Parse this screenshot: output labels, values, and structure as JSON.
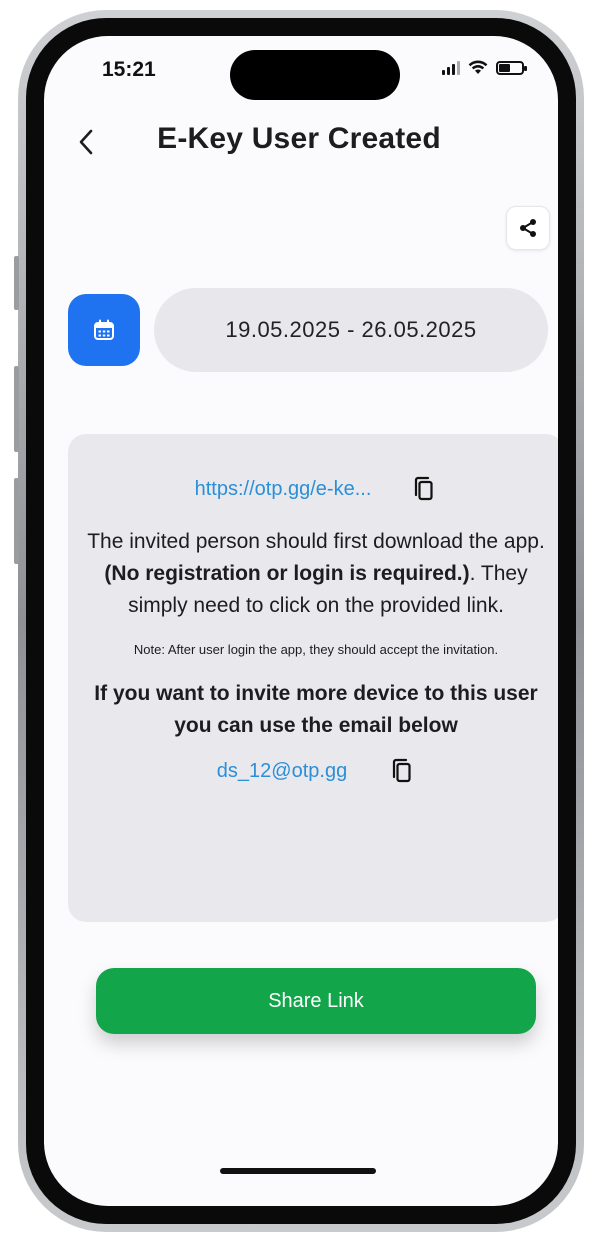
{
  "status_bar": {
    "time": "15:21"
  },
  "header": {
    "title": "E-Key User Created",
    "back_icon": "chevron-left-icon"
  },
  "toolbar": {
    "share_icon": "share-icon"
  },
  "date_range": {
    "icon": "calendar-icon",
    "value": "19.05.2025 - 26.05.2025"
  },
  "info_card": {
    "link": "https://otp.gg/e-ke...",
    "instructions_part1": "The invited person should first download the app. ",
    "instructions_bold": "(No registration or login is required.)",
    "instructions_part2": ". They simply need to click on the provided link.",
    "note": "Note: After user login the app, they should accept the invitation.",
    "invite_heading": "If you want to invite more device to this user you can use the email below",
    "email": "ds_12@otp.gg"
  },
  "actions": {
    "share_link_label": "Share Link"
  },
  "colors": {
    "accent_blue": "#1f73f0",
    "link_blue": "#2b8fd8",
    "primary_green": "#13a54a",
    "card_bg": "#e9e9ed",
    "pill_bg": "#e8e8ec"
  }
}
